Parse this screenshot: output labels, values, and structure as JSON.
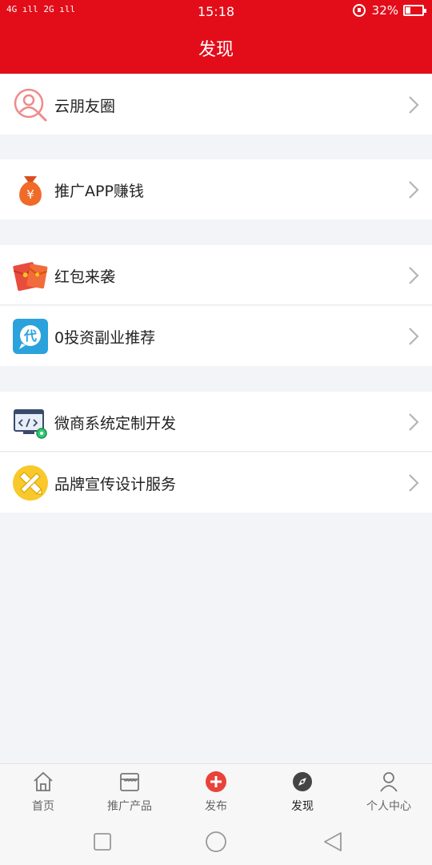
{
  "status_bar": {
    "signal_text": "4G ıll 2G ıll",
    "time": "15:18",
    "battery_percent_text": "32%",
    "battery_level": 0.32
  },
  "header": {
    "title": "发现"
  },
  "menu": {
    "items": [
      {
        "label": "云朋友圈",
        "icon": "search-person-icon"
      },
      {
        "label": "推广APP赚钱",
        "icon": "money-bag-icon"
      },
      {
        "label": "红包来袭",
        "icon": "red-envelope-icon"
      },
      {
        "label": "0投资副业推荐",
        "icon": "dai-icon",
        "icon_text": "代"
      },
      {
        "label": "微商系统定制开发",
        "icon": "code-monitor-icon"
      },
      {
        "label": "品牌宣传设计服务",
        "icon": "design-tools-icon"
      }
    ],
    "bag_symbol": "¥"
  },
  "tabbar": {
    "tabs": [
      {
        "label": "首页",
        "icon": "home-icon"
      },
      {
        "label": "推广产品",
        "icon": "store-icon"
      },
      {
        "label": "发布",
        "icon": "plus-circle-icon"
      },
      {
        "label": "发现",
        "icon": "compass-icon",
        "active": true
      },
      {
        "label": "个人中心",
        "icon": "person-icon"
      }
    ]
  },
  "colors": {
    "brand_red": "#e30d1a",
    "background": "#f3f4f8",
    "chevron": "#b5b5b5"
  }
}
